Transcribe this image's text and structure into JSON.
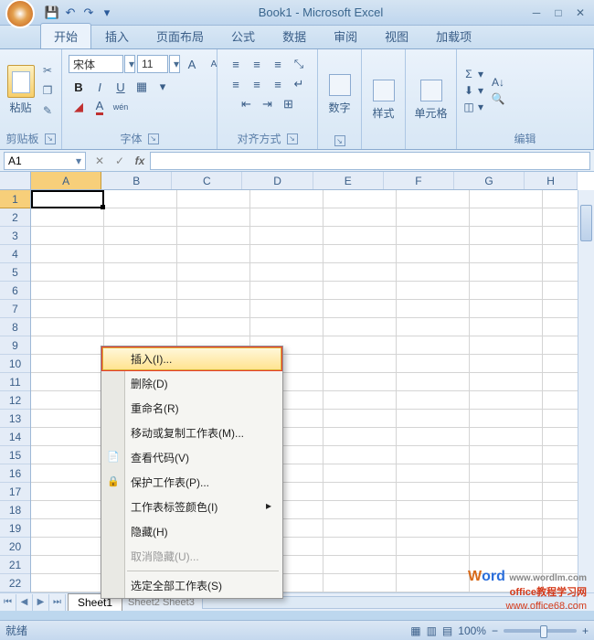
{
  "titlebar": {
    "title": "Book1 - Microsoft Excel"
  },
  "tabs": {
    "active": "开始",
    "items": [
      "开始",
      "插入",
      "页面布局",
      "公式",
      "数据",
      "审阅",
      "视图",
      "加载项"
    ]
  },
  "ribbon": {
    "clipboard": {
      "label": "剪贴板",
      "paste": "粘贴"
    },
    "font": {
      "label": "字体",
      "name": "宋体",
      "size": "11",
      "bold": "B",
      "italic": "I",
      "underline": "U"
    },
    "alignment": {
      "label": "对齐方式"
    },
    "number": {
      "label": "数字"
    },
    "styles": {
      "label": "样式"
    },
    "cells": {
      "label": "单元格"
    },
    "editing": {
      "label": "编辑"
    }
  },
  "namebox": "A1",
  "grid": {
    "columns": [
      "A",
      "B",
      "C",
      "D",
      "E",
      "F",
      "G",
      "H"
    ],
    "rows": [
      "1",
      "2",
      "3",
      "4",
      "5",
      "6",
      "7",
      "8",
      "9",
      "10",
      "11",
      "12",
      "13",
      "14",
      "15",
      "16",
      "17",
      "18",
      "19",
      "20",
      "21",
      "22"
    ],
    "active_cell": "A1"
  },
  "sheets": {
    "active": "Sheet1",
    "visible_label": "Sheet1"
  },
  "context_menu": {
    "items": [
      {
        "label": "插入(I)...",
        "hover": true
      },
      {
        "label": "删除(D)"
      },
      {
        "label": "重命名(R)"
      },
      {
        "label": "移动或复制工作表(M)..."
      },
      {
        "label": "查看代码(V)",
        "icon": "code"
      },
      {
        "label": "保护工作表(P)...",
        "icon": "lock"
      },
      {
        "label": "工作表标签颜色(I)",
        "submenu": true
      },
      {
        "label": "隐藏(H)"
      },
      {
        "label": "取消隐藏(U)...",
        "disabled": true
      },
      {
        "label": "选定全部工作表(S)"
      }
    ]
  },
  "status": {
    "ready": "就绪",
    "zoom": "100%"
  },
  "watermark": {
    "brand_prefix": "W",
    "brand_rest": "ord",
    "url1": "www.wordlm.com",
    "line2": "office教程学习网",
    "url2": "www.office68.com"
  }
}
